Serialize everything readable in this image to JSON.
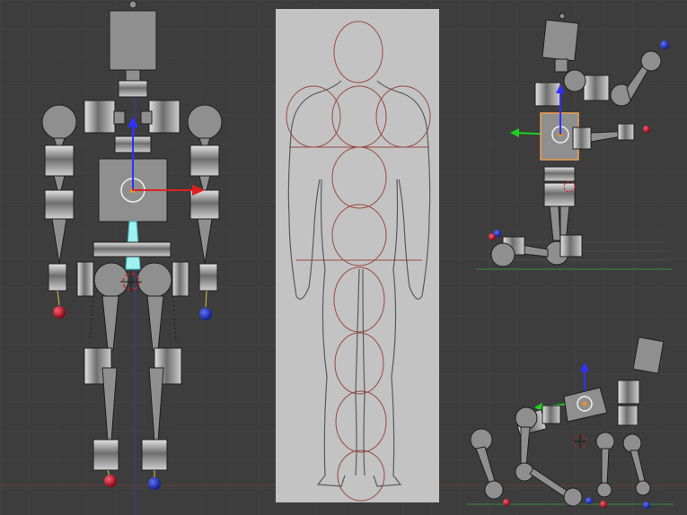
{
  "app": "3d-viewport",
  "viewport": {
    "background_color": "#3d3d3d",
    "grid_color": "#474747",
    "panels": [
      "front-view-rig",
      "reference-sketch",
      "perspective-biped-pose",
      "perspective-quadruped-pose"
    ]
  },
  "colors": {
    "part_fill": "#8f8f8f",
    "part_stroke": "#1e1e1e",
    "ring_fill": "#dcdcdc",
    "selection_outline": "#f0a050",
    "axis_x": "#e02020",
    "axis_y": "#20d020",
    "axis_z": "#3030ff",
    "handle_red": "#b0001a",
    "handle_blue": "#1030b0",
    "sketch_paper": "#c3c3c3",
    "sketch_circles": "#9a4a40"
  },
  "icons": [
    "object-origin-icon",
    "3d-cursor-icon",
    "transform-gizmo-icon"
  ]
}
